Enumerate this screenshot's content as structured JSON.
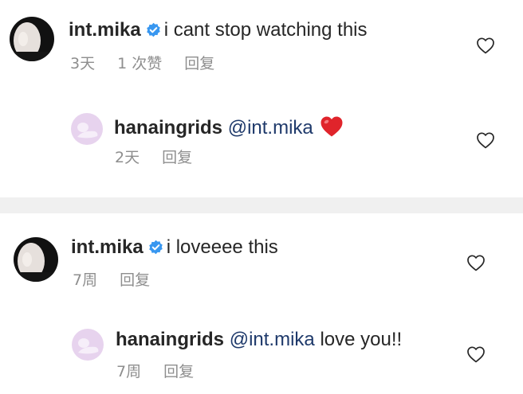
{
  "threads": [
    {
      "comment": {
        "username": "int.mika",
        "text": "i cant stop watching this",
        "time": "3天",
        "likes": "1 次赞",
        "reply_label": "回复"
      },
      "reply": {
        "username": "hanaingrids",
        "mention": "@int.mika",
        "text": "",
        "emoji": "red-heart",
        "time": "2天",
        "reply_label": "回复"
      }
    },
    {
      "comment": {
        "username": "int.mika",
        "text": "i loveeee this",
        "time": "7周",
        "reply_label": "回复"
      },
      "reply": {
        "username": "hanaingrids",
        "mention": "@int.mika",
        "text": "love you!!",
        "time": "7周",
        "reply_label": "回复"
      }
    }
  ],
  "icons": {
    "verified": "verified-badge-icon",
    "like": "heart-outline-icon",
    "emoji": "red-heart-emoji"
  },
  "colors": {
    "verified": "#3897f0",
    "mention": "#1f3a6b",
    "meta": "#8e8e8e",
    "heart": "#e0242b"
  }
}
